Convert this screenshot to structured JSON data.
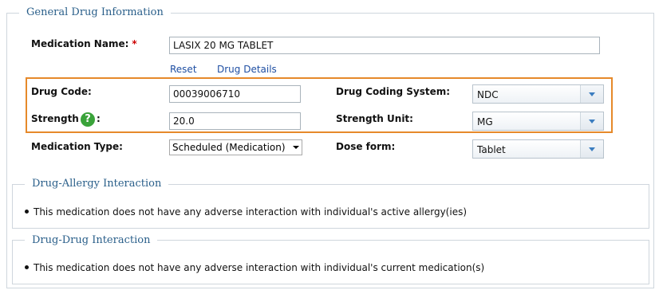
{
  "general": {
    "legend": "General Drug Information",
    "medication_name_label": "Medication Name:",
    "required_mark": "*",
    "medication_name_value": "LASIX 20 MG TABLET",
    "reset_link": "Reset",
    "drug_details_link": "Drug Details",
    "drug_code_label": "Drug Code:",
    "drug_code_value": "00039006710",
    "strength_label": "Strength",
    "strength_colon": ":",
    "strength_value": "20.0",
    "medication_type_label": "Medication Type:",
    "medication_type_value": "Scheduled (Medication)",
    "drug_coding_system_label": "Drug Coding System:",
    "drug_coding_system_value": "NDC",
    "strength_unit_label": "Strength Unit:",
    "strength_unit_value": "MG",
    "dose_form_label": "Dose form:",
    "dose_form_value": "Tablet",
    "help_icon_glyph": "?"
  },
  "allergy": {
    "legend": "Drug-Allergy Interaction",
    "message": "This medication does not have any adverse interaction with individual's active allergy(ies)"
  },
  "drug_drug": {
    "legend": "Drug-Drug Interaction",
    "message": "This medication does not have any adverse interaction with individual's current medication(s)"
  },
  "colors": {
    "highlight_border": "#e6892a",
    "legend_text": "#2a5f8a",
    "link": "#1f4fa3",
    "required": "#cc0000",
    "help_icon": "#3aa33a"
  },
  "icons": [
    "help-icon",
    "dropdown-arrow-icon",
    "bullet-icon"
  ]
}
